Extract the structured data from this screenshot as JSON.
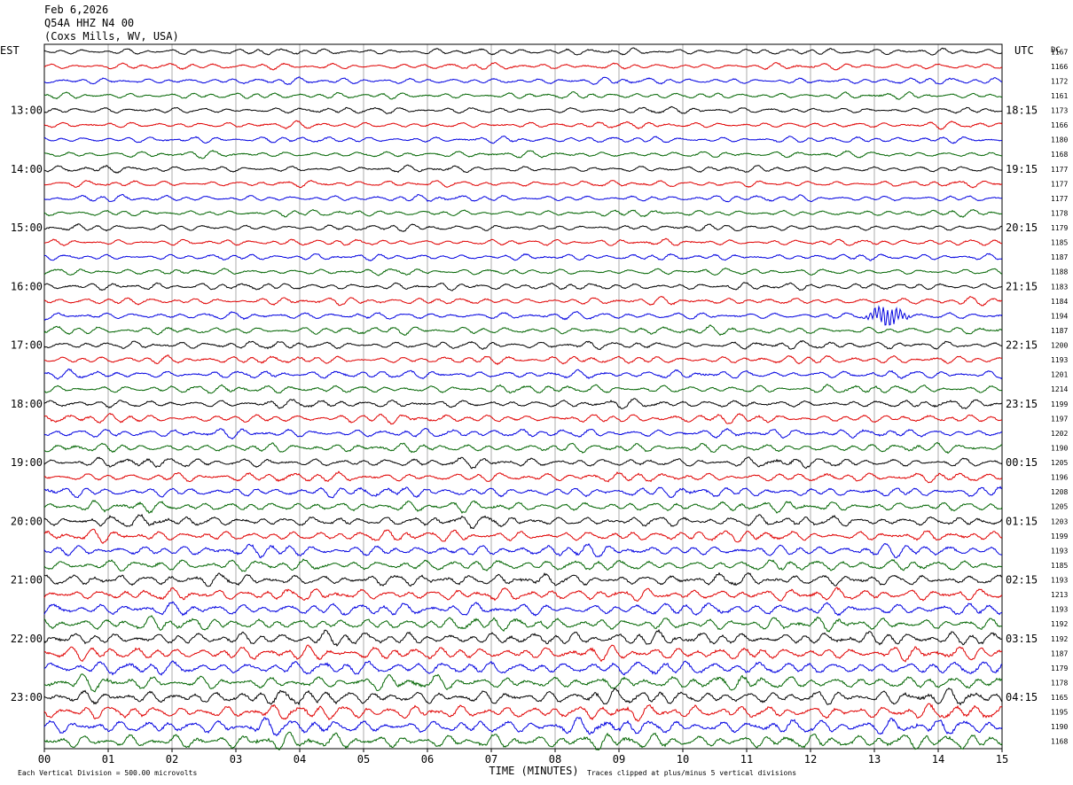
{
  "header": {
    "date": "Feb 6,2026",
    "station": "Q54A HHZ N4 00",
    "location": "(Coxs Mills, WV, USA)"
  },
  "left_zone_label": "EST",
  "right_zone_label": "UTC",
  "right_column_header": "DC",
  "footer": {
    "scale_note": "Each Vertical Division =  500.00 microvolts",
    "clip_note": "Traces clipped at plus/minus 5 vertical divisions",
    "x_axis_title": "TIME (MINUTES)"
  },
  "colors": {
    "trace_cycle": [
      "#000000",
      "#e00000",
      "#0000e0",
      "#006400"
    ],
    "grid": "#000000"
  },
  "chart_data": {
    "type": "line",
    "title": "Feb 6,2026",
    "xlabel": "TIME (MINUTES)",
    "xlim": [
      0,
      15
    ],
    "x_ticks": [
      "00",
      "01",
      "02",
      "03",
      "04",
      "05",
      "06",
      "07",
      "08",
      "09",
      "10",
      "11",
      "12",
      "13",
      "14",
      "15"
    ],
    "row_minutes": 15,
    "left_hour_labels": [
      "13:00",
      "14:00",
      "15:00",
      "16:00",
      "17:00",
      "18:00",
      "19:00",
      "20:00",
      "21:00",
      "22:00",
      "23:00"
    ],
    "right_hour_labels": [
      "18:15",
      "19:15",
      "20:15",
      "21:15",
      "22:15",
      "23:15",
      "00:15",
      "01:15",
      "02:15",
      "03:15",
      "04:15"
    ],
    "hour_label_first_row": 4,
    "hour_label_step_rows": 4,
    "dc_offsets": [
      1167,
      1166,
      1172,
      1161,
      1173,
      1166,
      1180,
      1168,
      1177,
      1177,
      1177,
      1178,
      1179,
      1185,
      1187,
      1188,
      1183,
      1184,
      1194,
      1187,
      1200,
      1193,
      1201,
      1214,
      1199,
      1197,
      1202,
      1190,
      1205,
      1196,
      1208,
      1205,
      1203,
      1199,
      1193,
      1185,
      1193,
      1213,
      1193,
      1192,
      1192,
      1187,
      1179,
      1178,
      1165,
      1195,
      1190,
      1168
    ],
    "trace_amplitude_divisions": [
      2,
      2,
      2,
      2,
      2,
      2,
      2,
      2,
      2,
      2,
      2,
      2,
      2,
      2,
      2,
      2,
      2.3,
      2.3,
      2.3,
      2.5,
      2.5,
      2.5,
      2.6,
      2.6,
      2.6,
      2.8,
      2.8,
      2.8,
      3,
      3,
      3.2,
      3.2,
      3.5,
      3.5,
      3.6,
      3.6,
      3.8,
      3.8,
      4,
      4,
      4.2,
      4.2,
      4.4,
      4.4,
      4.6,
      4.6,
      4.8,
      4.8
    ],
    "events": [
      {
        "row": 18,
        "start_minute": 12.7,
        "end_minute": 13.6,
        "peak_minute": 13.2,
        "amplitude_divisions": 5
      }
    ],
    "clip_divisions": 5
  }
}
